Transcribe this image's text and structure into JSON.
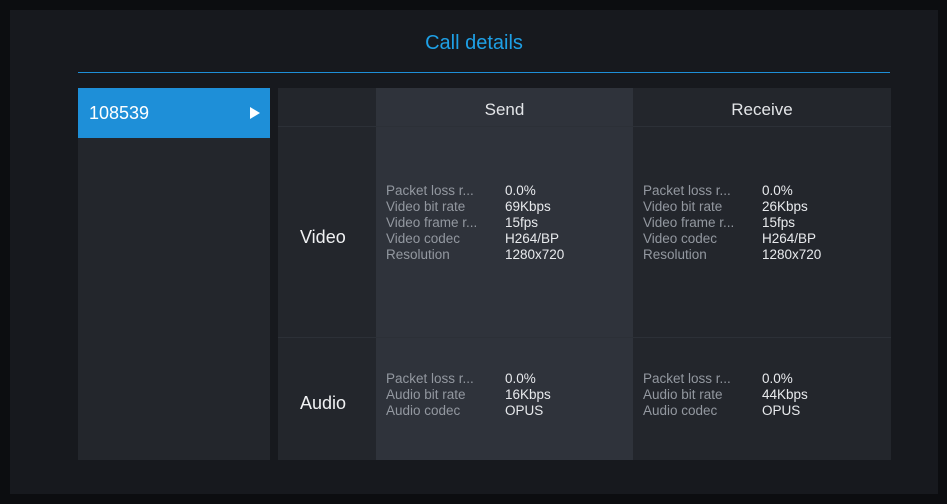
{
  "title": "Call details",
  "calls": [
    {
      "label": "108539",
      "selected": true
    }
  ],
  "columns": {
    "send": "Send",
    "receive": "Receive"
  },
  "rows": {
    "video": "Video",
    "audio": "Audio"
  },
  "video": {
    "send": [
      {
        "name": "Packet loss r...",
        "value": "0.0%"
      },
      {
        "name": "Video bit rate",
        "value": "69Kbps"
      },
      {
        "name": "Video frame r...",
        "value": "15fps"
      },
      {
        "name": "Video codec",
        "value": "H264/BP"
      },
      {
        "name": "Resolution",
        "value": "1280x720"
      }
    ],
    "receive": [
      {
        "name": "Packet loss r...",
        "value": "0.0%"
      },
      {
        "name": "Video bit rate",
        "value": "26Kbps"
      },
      {
        "name": "Video frame r...",
        "value": "15fps"
      },
      {
        "name": "Video codec",
        "value": "H264/BP"
      },
      {
        "name": "Resolution",
        "value": "1280x720"
      }
    ]
  },
  "audio": {
    "send": [
      {
        "name": "Packet loss r...",
        "value": "0.0%"
      },
      {
        "name": "Audio bit rate",
        "value": "16Kbps"
      },
      {
        "name": "Audio codec",
        "value": "OPUS"
      }
    ],
    "receive": [
      {
        "name": "Packet loss r...",
        "value": "0.0%"
      },
      {
        "name": "Audio bit rate",
        "value": "44Kbps"
      },
      {
        "name": "Audio codec",
        "value": "OPUS"
      }
    ]
  },
  "colors": {
    "accent": "#1e8fd8",
    "title": "#1ea0e6",
    "background": "#17191e",
    "panel": "#23262c",
    "send_column": "#2f333b"
  },
  "icons": {
    "call_item": "play-icon"
  }
}
